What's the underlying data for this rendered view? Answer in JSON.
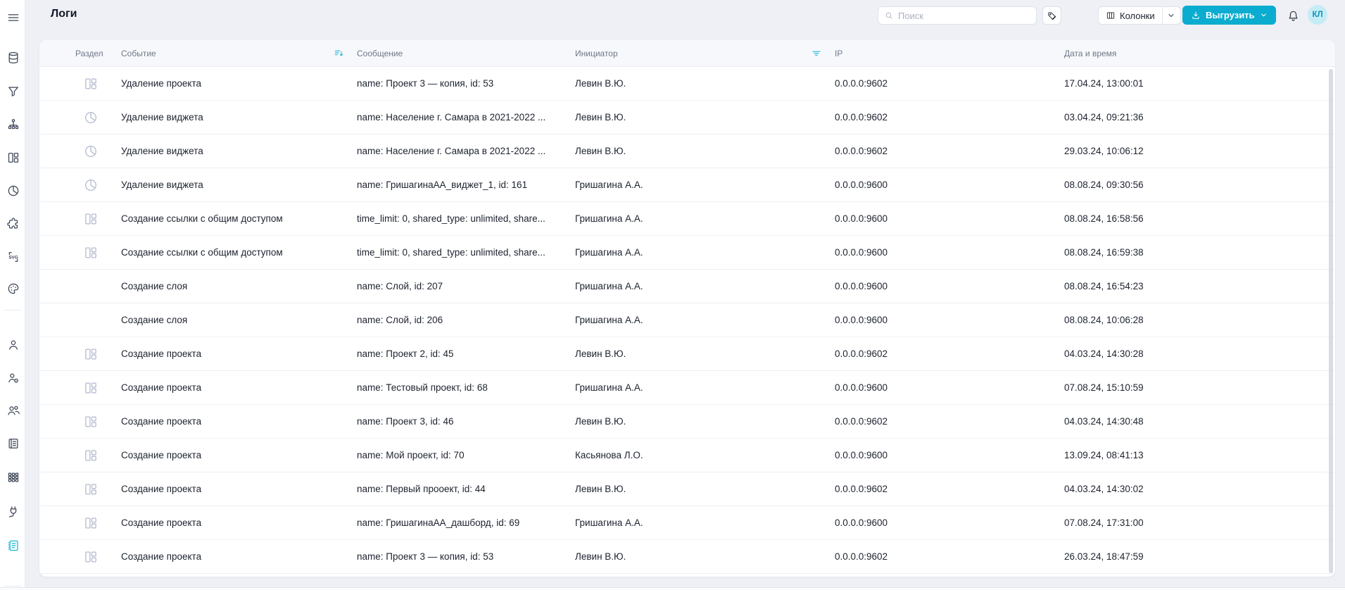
{
  "page": {
    "title": "Логи"
  },
  "colors": {
    "accent": "#0baccf",
    "accent_light": "#c6ecf6",
    "active_sidebar_icon": "#14b4d6",
    "header_indicator": "#27b9dc",
    "row_icon": "#b3bacf"
  },
  "topbar": {
    "search": {
      "placeholder": "Поиск",
      "value": ""
    },
    "tag_button": {
      "icon": "tag-icon"
    },
    "columns_button": {
      "label": "Колонки",
      "icon": "columns-icon"
    },
    "export_button": {
      "label": "Выгрузить",
      "icon": "download-icon"
    },
    "bell": {
      "icon": "bell-icon"
    },
    "avatar": {
      "initials": "КЛ"
    }
  },
  "sidebar": {
    "items": [
      {
        "name": "menu",
        "icon": "hamburger-icon"
      },
      {
        "name": "database",
        "icon": "database-icon"
      },
      {
        "name": "filters",
        "icon": "funnel-icon"
      },
      {
        "name": "hierarchy",
        "icon": "sitemap-icon"
      },
      {
        "name": "dashboards",
        "icon": "layout-icon"
      },
      {
        "name": "charts",
        "icon": "pie-chart-icon"
      },
      {
        "name": "plugins",
        "icon": "puzzle-icon"
      },
      {
        "name": "svg-assets",
        "icon": "svg-icon"
      },
      {
        "name": "palette",
        "icon": "palette-icon"
      },
      {
        "name": "user",
        "icon": "person-icon"
      },
      {
        "name": "user-settings",
        "icon": "person-gear-icon"
      },
      {
        "name": "groups",
        "icon": "people-icon"
      },
      {
        "name": "journal",
        "icon": "book-icon"
      },
      {
        "name": "apps",
        "icon": "apps-grid-icon"
      },
      {
        "name": "integrations",
        "icon": "plug-icon"
      },
      {
        "name": "logs",
        "icon": "logs-icon",
        "active": true
      }
    ]
  },
  "table": {
    "columns": [
      {
        "key": "section",
        "label": "Раздел"
      },
      {
        "key": "event",
        "label": "Событие",
        "indicator": "sort-desc-icon"
      },
      {
        "key": "message",
        "label": "Сообщение"
      },
      {
        "key": "initiator",
        "label": "Инициатор",
        "indicator": "filter-icon"
      },
      {
        "key": "ip",
        "label": "IP"
      },
      {
        "key": "datetime",
        "label": "Дата и время"
      }
    ],
    "rows": [
      {
        "icon": "dashboard-icon",
        "event": "Удаление проекта",
        "message": "name: Проект 3 — копия, id: 53",
        "initiator": "Левин В.Ю.",
        "ip": "0.0.0.0:9602",
        "datetime": "17.04.24, 13:00:01"
      },
      {
        "icon": "pie-chart-icon",
        "event": "Удаление виджета",
        "message": "name: Население г. Самара в 2021-2022 ...",
        "initiator": "Левин В.Ю.",
        "ip": "0.0.0.0:9602",
        "datetime": "03.04.24, 09:21:36"
      },
      {
        "icon": "pie-chart-icon",
        "event": "Удаление виджета",
        "message": "name: Население г. Самара в 2021-2022 ...",
        "initiator": "Левин В.Ю.",
        "ip": "0.0.0.0:9602",
        "datetime": "29.03.24, 10:06:12"
      },
      {
        "icon": "pie-chart-icon",
        "event": "Удаление виджета",
        "message": "name: ГришагинаАА_виджет_1, id: 161",
        "initiator": "Гришагина А.А.",
        "ip": "0.0.0.0:9600",
        "datetime": "08.08.24, 09:30:56"
      },
      {
        "icon": "dashboard-icon",
        "event": "Создание ссылки с общим доступом",
        "message": "time_limit: 0, shared_type: unlimited, share...",
        "initiator": "Гришагина А.А.",
        "ip": "0.0.0.0:9600",
        "datetime": "08.08.24, 16:58:56"
      },
      {
        "icon": "dashboard-icon",
        "event": "Создание ссылки с общим доступом",
        "message": "time_limit: 0, shared_type: unlimited, share...",
        "initiator": "Гришагина А.А.",
        "ip": "0.0.0.0:9600",
        "datetime": "08.08.24, 16:59:38"
      },
      {
        "icon": null,
        "event": "Создание слоя",
        "message": "name: Слой, id: 207",
        "initiator": "Гришагина А.А.",
        "ip": "0.0.0.0:9600",
        "datetime": "08.08.24, 16:54:23"
      },
      {
        "icon": null,
        "event": "Создание слоя",
        "message": "name: Слой, id: 206",
        "initiator": "Гришагина А.А.",
        "ip": "0.0.0.0:9600",
        "datetime": "08.08.24, 10:06:28"
      },
      {
        "icon": "dashboard-icon",
        "event": "Создание проекта",
        "message": "name: Проект 2, id: 45",
        "initiator": "Левин В.Ю.",
        "ip": "0.0.0.0:9602",
        "datetime": "04.03.24, 14:30:28"
      },
      {
        "icon": "dashboard-icon",
        "event": "Создание проекта",
        "message": "name: Тестовый проект, id: 68",
        "initiator": "Гришагина А.А.",
        "ip": "0.0.0.0:9600",
        "datetime": "07.08.24, 15:10:59"
      },
      {
        "icon": "dashboard-icon",
        "event": "Создание проекта",
        "message": "name: Проект 3, id: 46",
        "initiator": "Левин В.Ю.",
        "ip": "0.0.0.0:9602",
        "datetime": "04.03.24, 14:30:48"
      },
      {
        "icon": "dashboard-icon",
        "event": "Создание проекта",
        "message": "name: Мой проект, id: 70",
        "initiator": "Касьянова Л.О.",
        "ip": "0.0.0.0:9600",
        "datetime": "13.09.24, 08:41:13"
      },
      {
        "icon": "dashboard-icon",
        "event": "Создание проекта",
        "message": "name: Первый прооект, id: 44",
        "initiator": "Левин В.Ю.",
        "ip": "0.0.0.0:9602",
        "datetime": "04.03.24, 14:30:02"
      },
      {
        "icon": "dashboard-icon",
        "event": "Создание проекта",
        "message": "name: ГришагинаАА_дашборд, id: 69",
        "initiator": "Гришагина А.А.",
        "ip": "0.0.0.0:9600",
        "datetime": "07.08.24, 17:31:00"
      },
      {
        "icon": "dashboard-icon",
        "event": "Создание проекта",
        "message": "name: Проект 3 — копия, id: 53",
        "initiator": "Левин В.Ю.",
        "ip": "0.0.0.0:9602",
        "datetime": "26.03.24, 18:47:59"
      }
    ]
  }
}
